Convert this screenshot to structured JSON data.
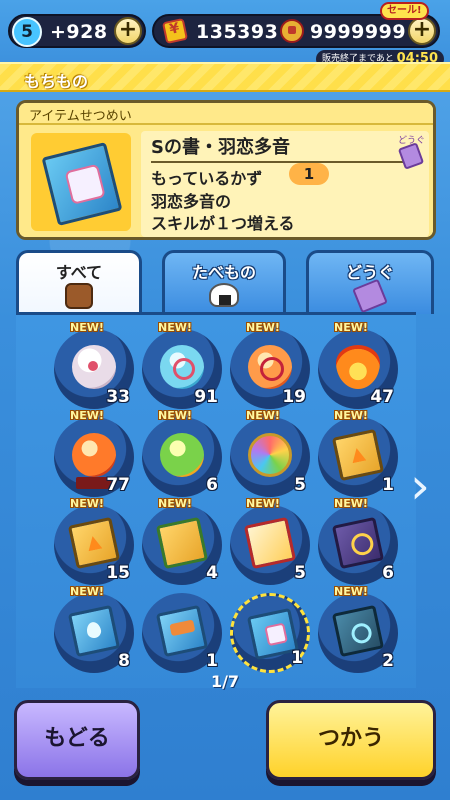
{
  "status": {
    "life_count": "5",
    "life_value": "+928",
    "coins": "135393",
    "gems": "9999999",
    "sale_label": "セール!",
    "timer_label": "販売終了まであと",
    "timer_value": "04:50"
  },
  "header": {
    "title": "もちもの"
  },
  "item_detail": {
    "header_label": "アイテムせつめい",
    "category_label": "どうぐ",
    "name": "Sの書・羽恋多音",
    "owned_label": "もっているかず",
    "owned_count": "1",
    "description": "羽恋多音の\nスキルが１つ増える"
  },
  "tabs": [
    {
      "label": "すべて",
      "icon": "bag-icon"
    },
    {
      "label": "たべもの",
      "icon": "rice-ball-icon"
    },
    {
      "label": "どうぐ",
      "icon": "ticket-icon"
    }
  ],
  "items": [
    {
      "qty": "33",
      "new": "NEW!",
      "art": "orb-white"
    },
    {
      "qty": "91",
      "new": "NEW!",
      "art": "orb-blue"
    },
    {
      "qty": "19",
      "new": "NEW!",
      "art": "orb-orange"
    },
    {
      "qty": "47",
      "new": "NEW!",
      "art": "orb-fire"
    },
    {
      "qty": "77",
      "new": "NEW!",
      "art": "orb-stand"
    },
    {
      "qty": "6",
      "new": "NEW!",
      "art": "orb-green"
    },
    {
      "qty": "5",
      "new": "NEW!",
      "art": "orb-rainbow"
    },
    {
      "qty": "1",
      "new": "NEW!",
      "art": "book-gold"
    },
    {
      "qty": "15",
      "new": "NEW!",
      "art": "book-gold"
    },
    {
      "qty": "4",
      "new": "NEW!",
      "art": "book-green"
    },
    {
      "qty": "5",
      "new": "NEW!",
      "art": "book-red"
    },
    {
      "qty": "6",
      "new": "NEW!",
      "art": "book-purple"
    },
    {
      "qty": "8",
      "new": "NEW!",
      "art": "book-blue"
    },
    {
      "qty": "1",
      "new": "",
      "art": "book-blue2"
    },
    {
      "qty": "1",
      "new": "",
      "art": "book-sel"
    },
    {
      "qty": "2",
      "new": "NEW!",
      "art": "book-dark"
    }
  ],
  "pager": {
    "label": "1/7"
  },
  "buttons": {
    "back": "もどる",
    "use": "つかう"
  }
}
